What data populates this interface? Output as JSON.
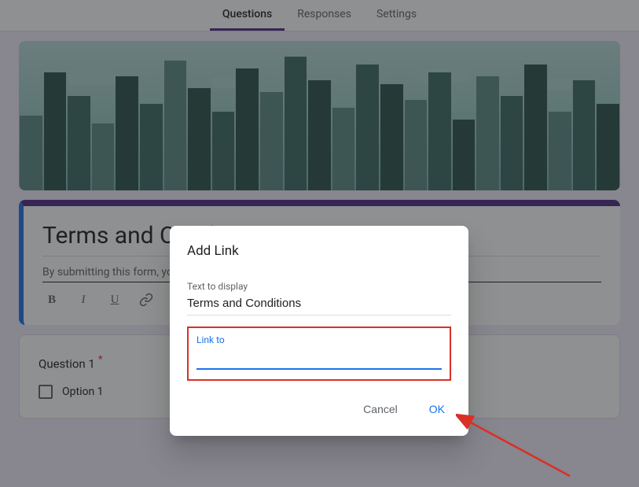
{
  "tabs": {
    "questions": "Questions",
    "responses": "Responses",
    "settings": "Settings"
  },
  "form": {
    "title": "Terms and Conditions",
    "description": "By submitting this form, you agree to the",
    "title_truncated_suffix": "s"
  },
  "question": {
    "title": "Question 1",
    "required_mark": "*",
    "option1": "Option 1"
  },
  "dialog": {
    "title": "Add Link",
    "text_to_display_label": "Text to display",
    "text_to_display_value": "Terms and Conditions",
    "link_to_label": "Link to",
    "link_to_value": "",
    "cancel": "Cancel",
    "ok": "OK"
  },
  "toolbar": {
    "bold": "B",
    "italic": "I",
    "underline": "U"
  }
}
